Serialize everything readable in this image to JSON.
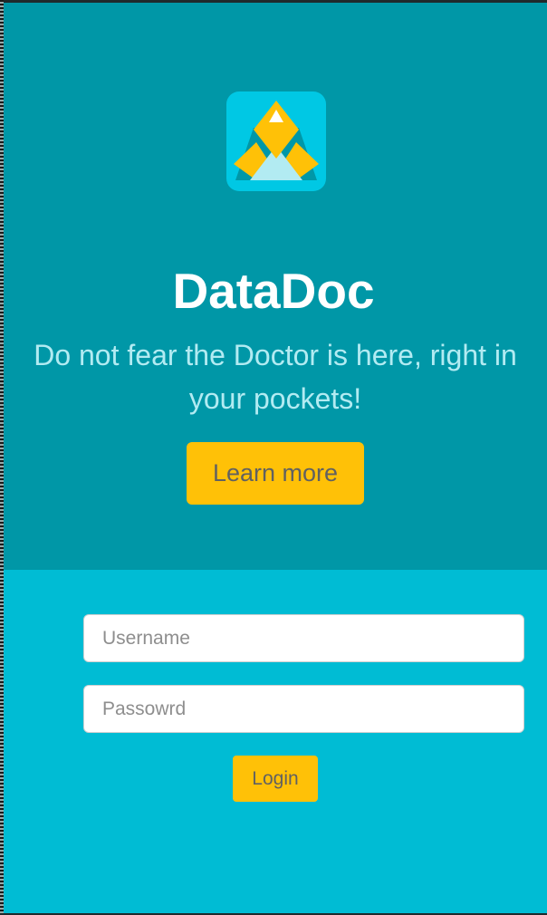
{
  "app": {
    "title": "DataDoc",
    "tagline": "Do not fear the Doctor is here, right in your pockets!",
    "logo_icon": "datadoc-logo-icon"
  },
  "hero": {
    "learn_more_label": "Learn more"
  },
  "login": {
    "username_placeholder": "Username",
    "password_placeholder": "Passowrd",
    "login_label": "Login"
  },
  "colors": {
    "hero_background": "#0097a7",
    "login_background": "#00bcd4",
    "accent": "#ffc107",
    "title_text": "#ffffff",
    "tagline_text": "#b2ebf2",
    "button_text": "#616161"
  }
}
